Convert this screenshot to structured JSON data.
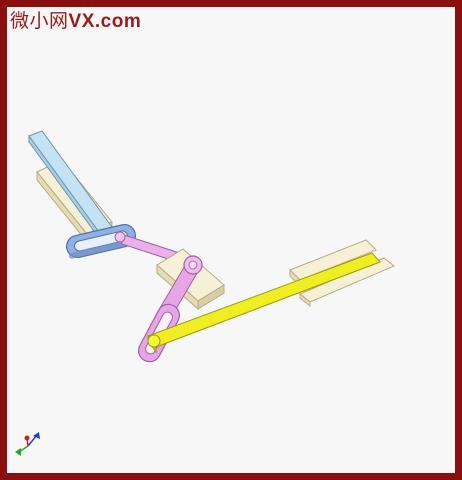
{
  "watermark": {
    "cn": "微小网",
    "en": "VX.com"
  },
  "colors": {
    "frame": "#8a0f0f",
    "watermark": "#9a1b1b",
    "slider_blue": "#b6dcf0",
    "link_blue": "#8fb3e3",
    "link_pink": "#e6a6e6",
    "bar_yellow": "#eeee22",
    "guide_cream": "#f4efcf"
  },
  "scene": {
    "parts": [
      "guide-block-upper",
      "slider-bar-blue",
      "slotted-link-blue",
      "connecting-link-pink",
      "pivot-block",
      "slotted-link-pink",
      "slider-bar-yellow",
      "guide-block-right",
      "axis-triad"
    ]
  }
}
